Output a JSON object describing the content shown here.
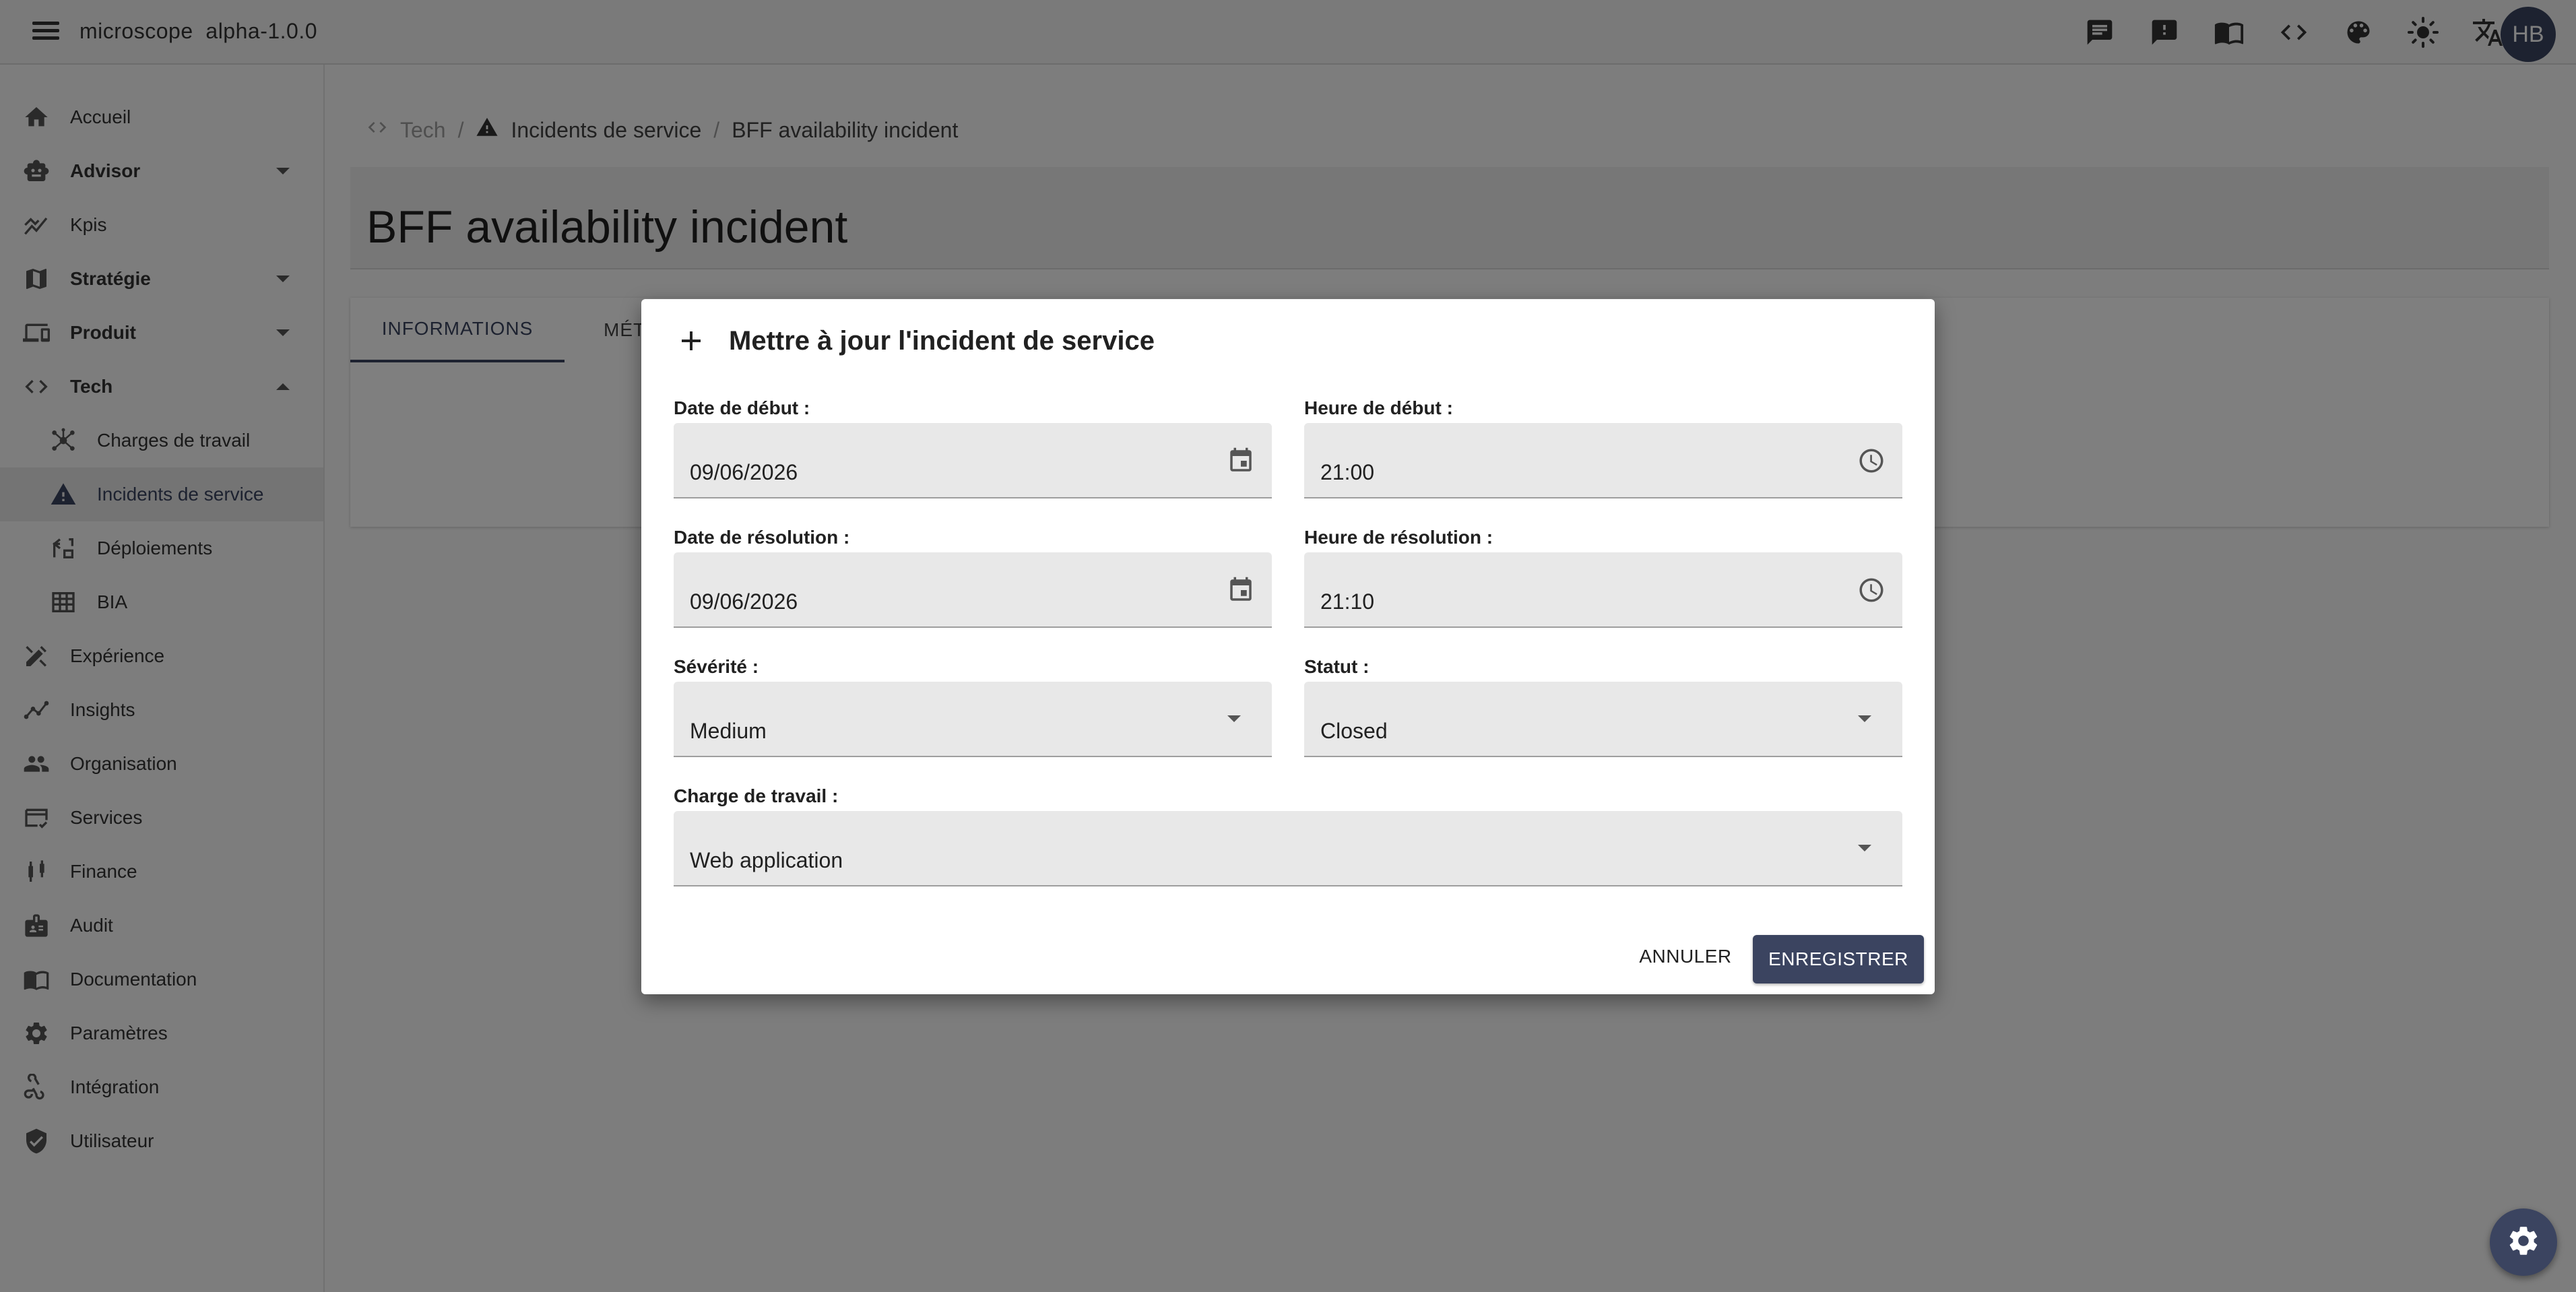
{
  "app": {
    "name": "microscope",
    "version": "alpha-1.0.0",
    "avatar_initials": "HB"
  },
  "topbar_icons": [
    "chat-icon",
    "feedback-icon",
    "docs-book-icon",
    "code-icon",
    "palette-icon",
    "theme-sun-icon",
    "translate-icon"
  ],
  "sidebar": {
    "items": [
      {
        "label": "Accueil",
        "icon": "home-icon",
        "bold": false
      },
      {
        "label": "Advisor",
        "icon": "robot-icon",
        "bold": true,
        "expand": "down"
      },
      {
        "label": "Kpis",
        "icon": "chart-line-icon",
        "bold": false
      },
      {
        "label": "Stratégie",
        "icon": "map-icon",
        "bold": true,
        "expand": "down"
      },
      {
        "label": "Produit",
        "icon": "devices-icon",
        "bold": true,
        "expand": "down"
      },
      {
        "label": "Tech",
        "icon": "code-icon",
        "bold": true,
        "expand": "up"
      },
      {
        "label": "Charges de travail",
        "icon": "hub-icon",
        "sub": true
      },
      {
        "label": "Incidents de service",
        "icon": "warning-icon",
        "sub": true,
        "active": true
      },
      {
        "label": "Déploiements",
        "icon": "deploy-icon",
        "sub": true
      },
      {
        "label": "BIA",
        "icon": "grid-icon",
        "sub": true
      },
      {
        "label": "Expérience",
        "icon": "design-icon",
        "bold": false
      },
      {
        "label": "Insights",
        "icon": "insights-icon",
        "bold": false
      },
      {
        "label": "Organisation",
        "icon": "people-icon",
        "bold": false
      },
      {
        "label": "Services",
        "icon": "card-check-icon",
        "bold": false
      },
      {
        "label": "Finance",
        "icon": "candlestick-icon",
        "bold": false
      },
      {
        "label": "Audit",
        "icon": "badge-icon",
        "bold": false
      },
      {
        "label": "Documentation",
        "icon": "book-icon",
        "bold": false
      },
      {
        "label": "Paramètres",
        "icon": "gear-icon",
        "bold": false
      },
      {
        "label": "Intégration",
        "icon": "webhook-icon",
        "bold": false
      },
      {
        "label": "Utilisateur",
        "icon": "shield-check-icon",
        "bold": false
      }
    ]
  },
  "breadcrumb": {
    "root": "Tech",
    "section": "Incidents de service",
    "current": "BFF availability incident"
  },
  "page": {
    "title": "BFF availability incident"
  },
  "tabs": [
    {
      "label": "INFORMATIONS"
    },
    {
      "label": "MÉT"
    }
  ],
  "dialog": {
    "title": "Mettre à jour l'incident de service",
    "start_date_label": "Date de début :",
    "start_date_value": "09/06/2026",
    "start_time_label": "Heure de début :",
    "start_time_value": "21:00",
    "resolution_date_label": "Date de résolution :",
    "resolution_date_value": "09/06/2026",
    "resolution_time_label": "Heure de résolution :",
    "resolution_time_value": "21:10",
    "severity_label": "Sévérité :",
    "severity_value": "Medium",
    "status_label": "Statut :",
    "status_value": "Closed",
    "workload_label": "Charge de travail :",
    "workload_value": "Web application",
    "cancel_label": "ANNULER",
    "save_label": "ENREGISTRER"
  },
  "colors": {
    "primary": "#3b4460",
    "overlay": "rgba(0,0,0,0.5)",
    "field_bg": "#e8e8e8"
  }
}
